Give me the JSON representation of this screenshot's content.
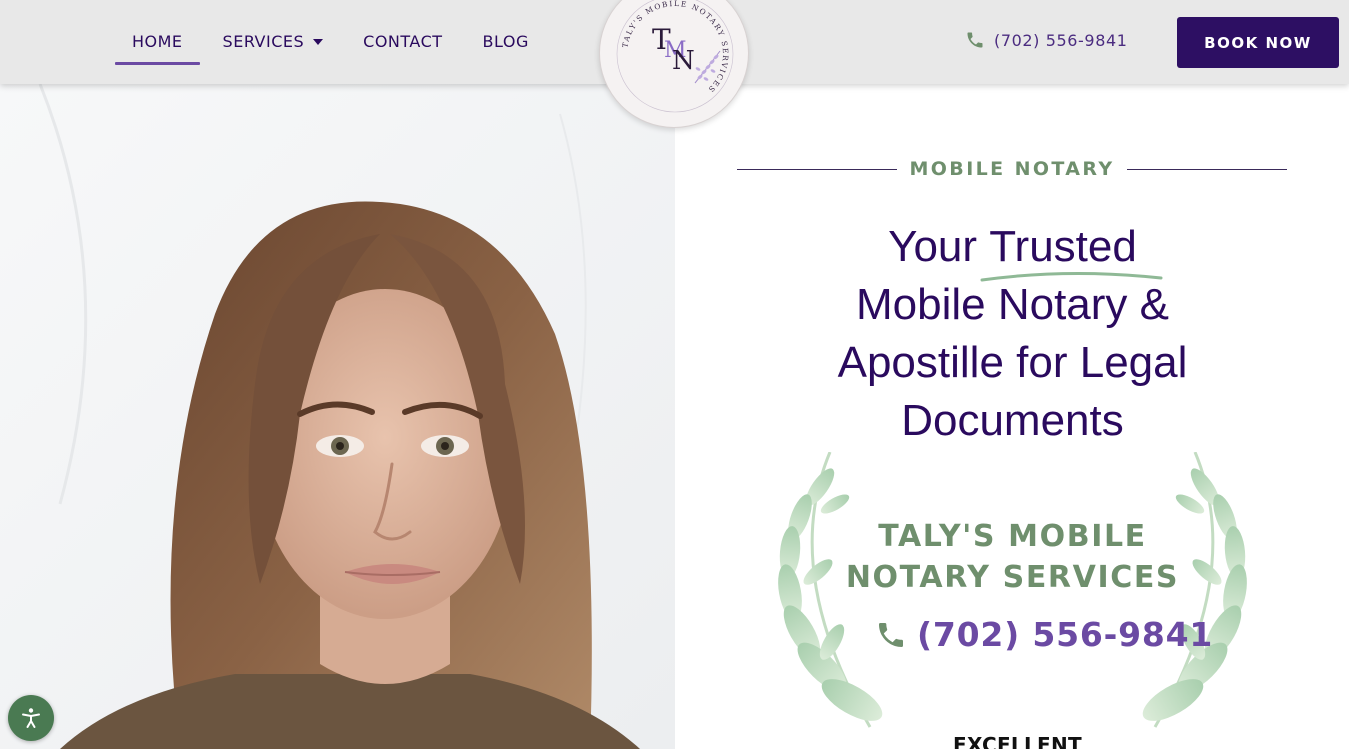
{
  "nav": {
    "items": [
      {
        "label": "HOME",
        "active": true
      },
      {
        "label": "SERVICES",
        "dropdown": true
      },
      {
        "label": "CONTACT"
      },
      {
        "label": "BLOG"
      }
    ]
  },
  "logo": {
    "monogram_t": "T",
    "monogram_m": "M",
    "monogram_n": "N",
    "ring_text": "TALY'S MOBILE NOTARY SERVICES"
  },
  "header": {
    "phone": "(702) 556-9841",
    "book_label": "BOOK NOW"
  },
  "hero": {
    "eyebrow": "MOBILE NOTARY",
    "headline_line1_a": "Your",
    "headline_line1_b": "Trusted",
    "headline_line2": "Mobile Notary &",
    "headline_line3": "Apostille for Legal",
    "headline_line4": "Documents",
    "company_line1": "TALY'S MOBILE",
    "company_line2": "NOTARY SERVICES",
    "phone": "(702) 556-9841",
    "rating_label": "EXCELLENT"
  },
  "icons": {
    "phone": "phone-icon",
    "accessibility": "accessibility-icon",
    "caret": "chevron-down-icon"
  },
  "colors": {
    "brand_purple": "#2d0f63",
    "accent_purple": "#6b4aa3",
    "sage_green": "#6f8f6d",
    "header_bg": "#e8e8e8"
  }
}
